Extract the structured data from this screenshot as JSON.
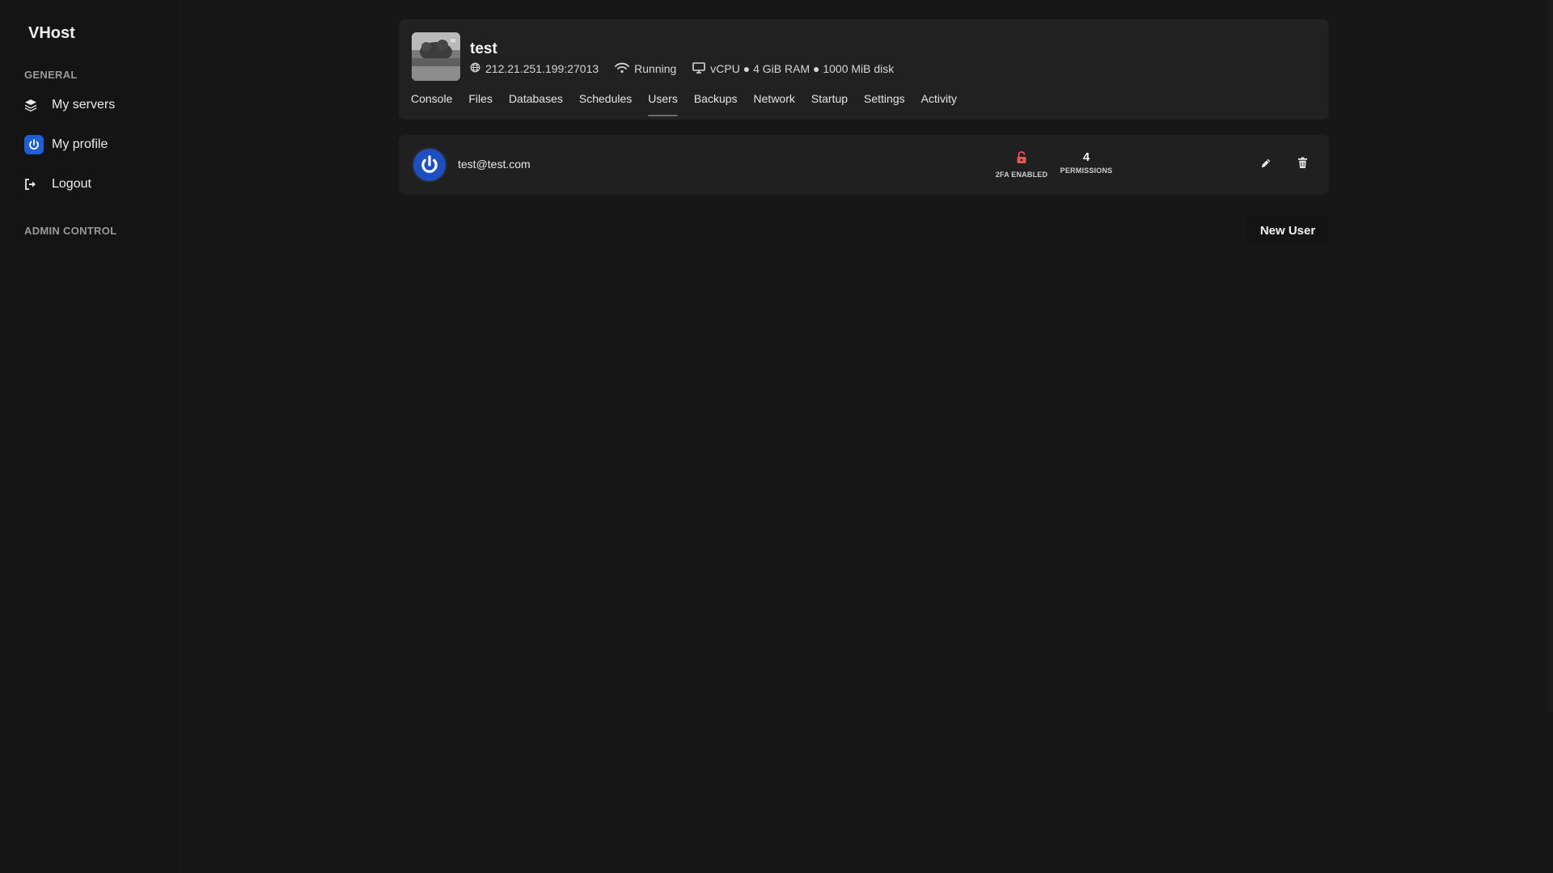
{
  "app": {
    "brand": "VHost"
  },
  "sidebar": {
    "general_label": "GENERAL",
    "items": [
      {
        "label": "My servers",
        "icon": "layers-icon"
      },
      {
        "label": "My profile",
        "icon": "power-icon"
      },
      {
        "label": "Logout",
        "icon": "logout-icon"
      }
    ],
    "admin_label": "ADMIN CONTROL"
  },
  "server": {
    "name": "test",
    "address": "212.21.251.199:27013",
    "status": "Running",
    "resources": "vCPU ● 4 GiB RAM ● 1000 MiB disk"
  },
  "tabs": [
    {
      "label": "Console"
    },
    {
      "label": "Files"
    },
    {
      "label": "Databases"
    },
    {
      "label": "Schedules"
    },
    {
      "label": "Users",
      "active": true
    },
    {
      "label": "Backups"
    },
    {
      "label": "Network"
    },
    {
      "label": "Startup"
    },
    {
      "label": "Settings"
    },
    {
      "label": "Activity"
    }
  ],
  "users": [
    {
      "email": "test@test.com",
      "twofa_label": "2FA ENABLED",
      "permissions_count": "4",
      "permissions_label": "PERMISSIONS"
    }
  ],
  "actions": {
    "new_user_label": "New User"
  },
  "colors": {
    "background": "#171717",
    "sidebar": "#141414",
    "card": "#212121",
    "accent_blue": "#1e5fd8",
    "lock_red": "#e0565b"
  }
}
